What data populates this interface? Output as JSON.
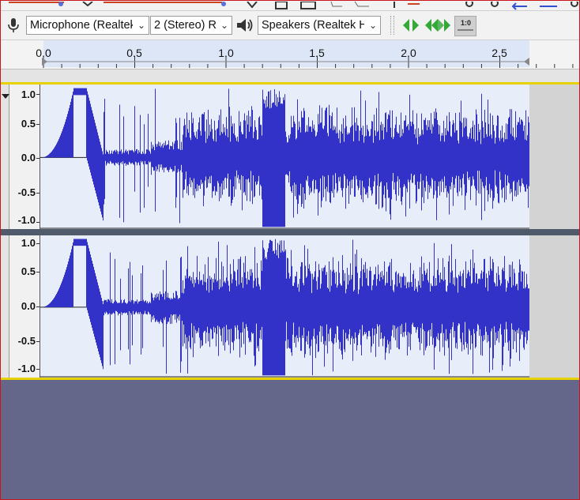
{
  "device_toolbar": {
    "recording_device": "Microphone (Realtek",
    "channels": "2 (Stereo) R",
    "playback_device": "Speakers (Realtek H"
  },
  "zoom_button_label": "1:0",
  "timeline": {
    "tick_labels": [
      "0.0",
      "0.5",
      "1.0",
      "1.5",
      "2.0",
      "2.5"
    ]
  },
  "vertical_ruler_labels": [
    "1.0",
    "0.5",
    "0.0",
    "-0.5",
    "-1.0"
  ],
  "tracks": [
    {
      "channel": "left"
    },
    {
      "channel": "right"
    }
  ],
  "colors": {
    "waveform": "#3232c8",
    "waveform_background": "#e8eef9",
    "empty_area": "#646789",
    "selection_marker": "#e6d200"
  }
}
